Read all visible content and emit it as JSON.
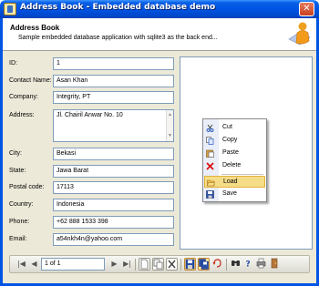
{
  "window": {
    "title": "Address Book - Embedded database demo",
    "close_glyph": "✕"
  },
  "header": {
    "title": "Address Book",
    "subtitle": "Sample embedded database application with sqlite3 as the back end..."
  },
  "form": {
    "fields": [
      {
        "label": "ID:",
        "value": "1"
      },
      {
        "label": "Contact Name:",
        "value": "Asan Khan"
      },
      {
        "label": "Company:",
        "value": "Integrity, PT"
      },
      {
        "label": "Address:",
        "value": "Jl. Chairil Anwar No. 10"
      },
      {
        "label": "City:",
        "value": "Bekasi"
      },
      {
        "label": "State:",
        "value": "Jawa Barat"
      },
      {
        "label": "Postal code:",
        "value": "17113"
      },
      {
        "label": "Country:",
        "value": "Indonesia"
      },
      {
        "label": "Phone:",
        "value": "+62 888 1533 398"
      },
      {
        "label": "Email:",
        "value": "a54nkh4n@yahoo.com"
      }
    ]
  },
  "context_menu": {
    "items": [
      {
        "label": "Cut",
        "icon": "scissors-icon"
      },
      {
        "label": "Copy",
        "icon": "copy-icon"
      },
      {
        "label": "Paste",
        "icon": "paste-icon"
      },
      {
        "label": "Delete",
        "icon": "delete-icon"
      },
      {
        "label": "Load",
        "icon": "folder-open-icon",
        "selected": true
      },
      {
        "label": "Save",
        "icon": "floppy-disk-icon"
      }
    ]
  },
  "navigator": {
    "position": "1 of 1",
    "first_glyph": "|◀",
    "prev_glyph": "◀",
    "next_glyph": "▶",
    "last_glyph": "▶|"
  },
  "colors": {
    "title_bar": "#0054e3",
    "window_bg": "#ece9d8",
    "field_border": "#7f9db9",
    "menu_highlight": "#f5dd88"
  }
}
